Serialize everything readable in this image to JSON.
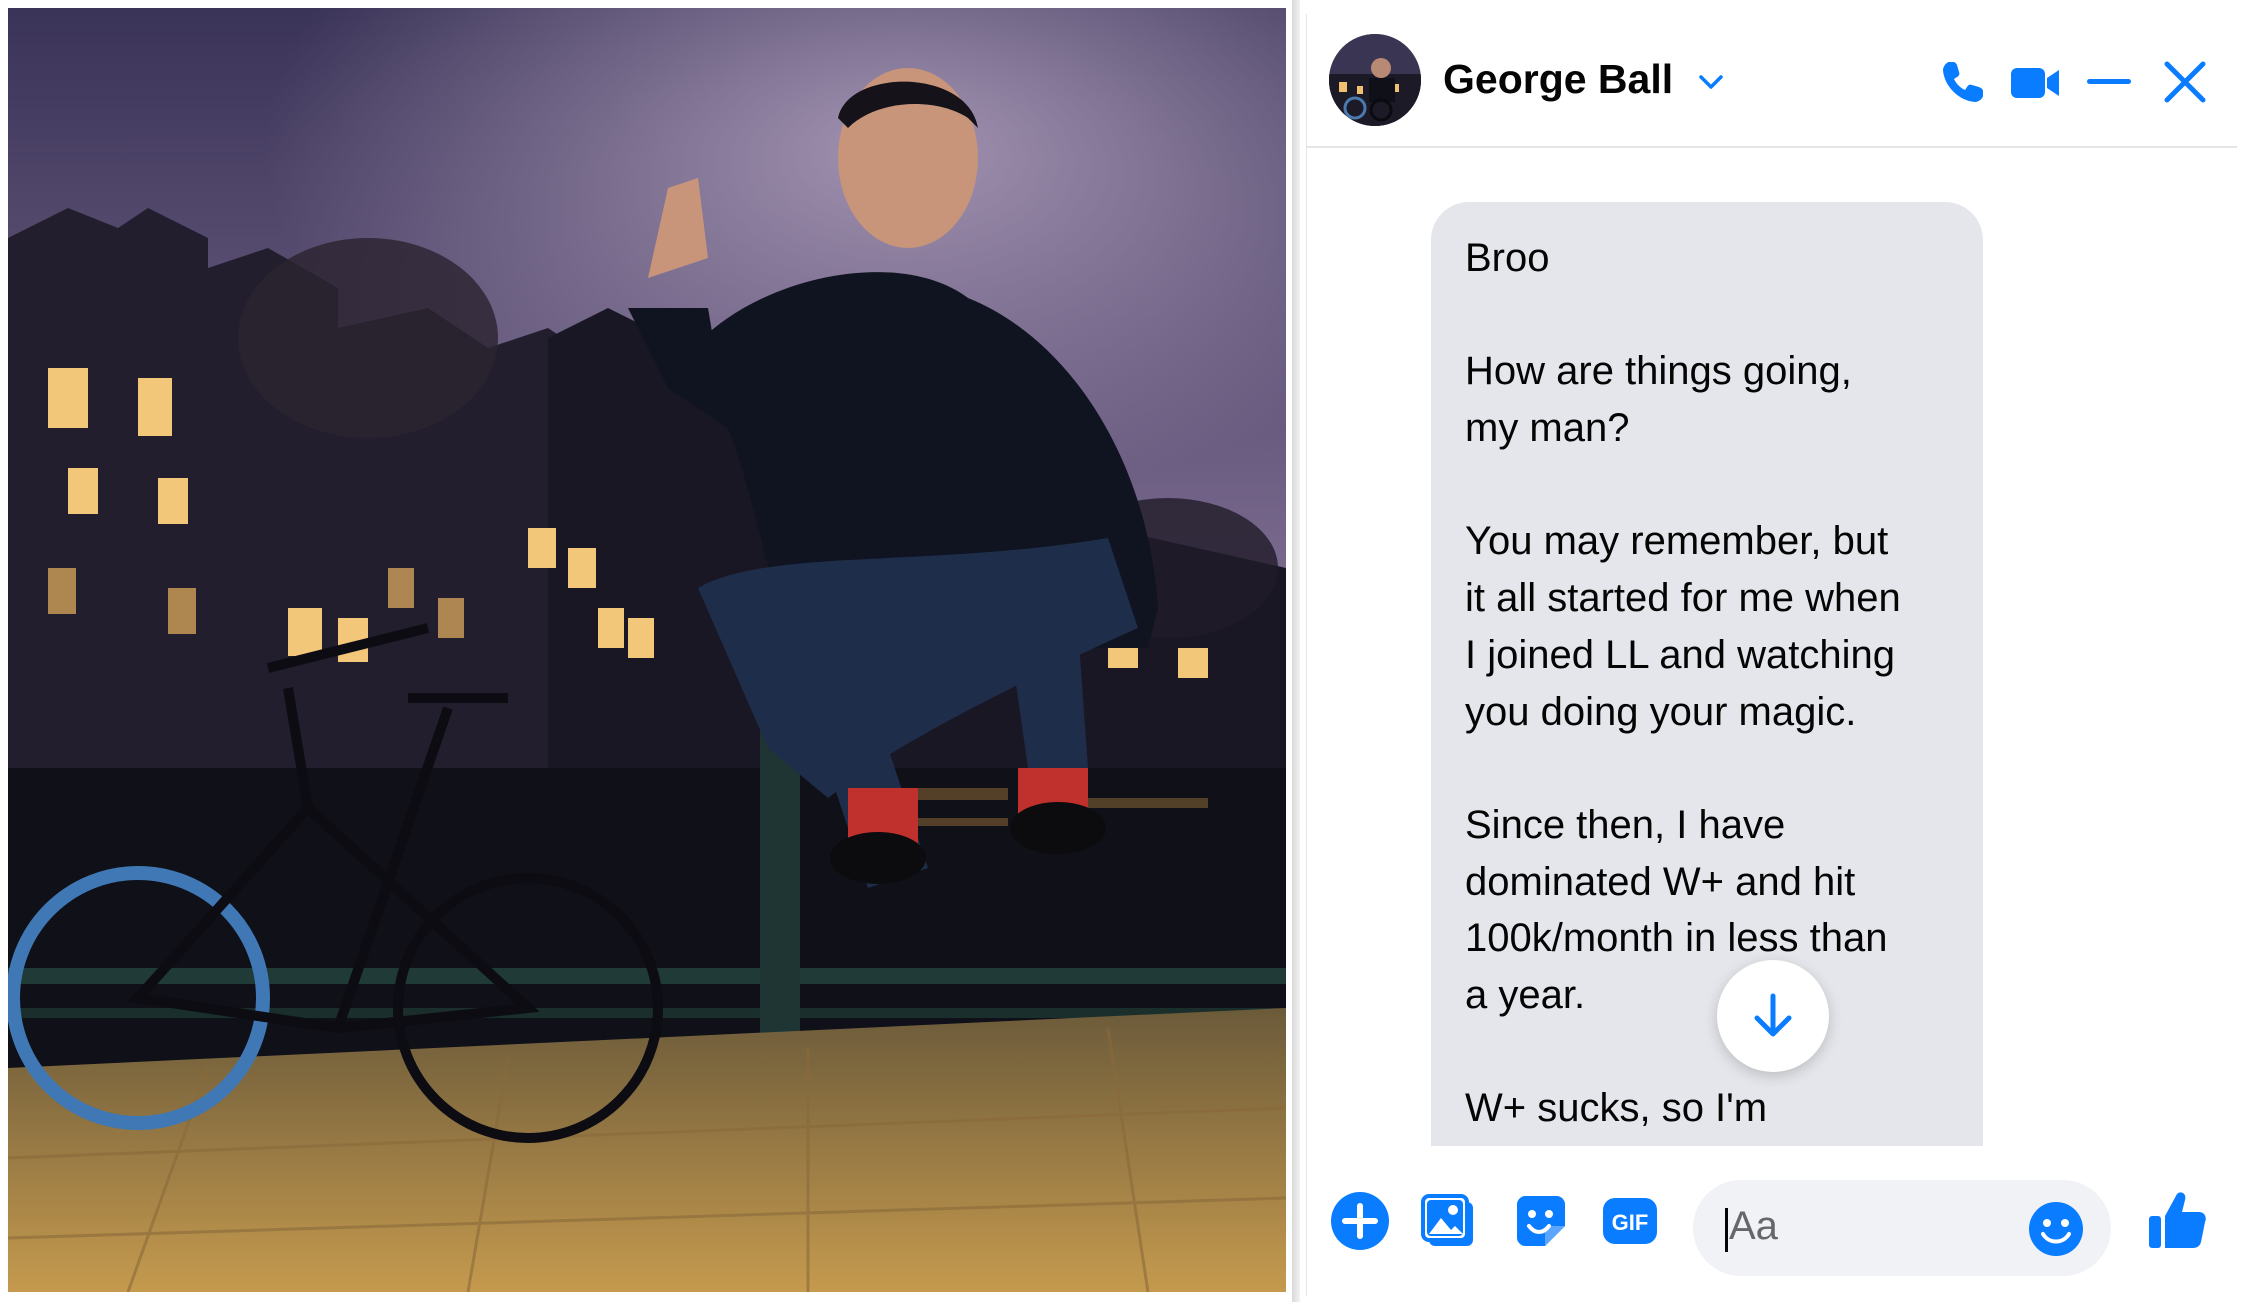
{
  "photo": {
    "description_icon": "photo"
  },
  "chat": {
    "contact_name": "George Ball",
    "header_icons": [
      "chevron-down-icon",
      "phone-icon",
      "video-icon",
      "minimize-icon",
      "close-icon"
    ],
    "message": {
      "paragraphs": [
        [
          "Broo"
        ],
        [
          "How are things going,",
          "my man?"
        ],
        [
          "You may remember, but",
          "it all started for me when",
          "I joined LL and watching",
          "you doing your magic."
        ],
        [
          "Since then, I have",
          "dominated W+ and hit",
          "100k/month in less than",
          "a year."
        ],
        [
          "W+ sucks, so I'm"
        ]
      ]
    },
    "composer": {
      "placeholder": "Aa",
      "gif_label": "GIF",
      "icons": [
        "plus-icon",
        "image-icon",
        "sticker-icon",
        "gif-icon",
        "emoji-icon",
        "thumbs-up-icon"
      ]
    }
  },
  "colors": {
    "accent": "#0a7cff",
    "bubble": "#e4e6eb",
    "text": "#050505",
    "placeholder": "#65676b"
  }
}
